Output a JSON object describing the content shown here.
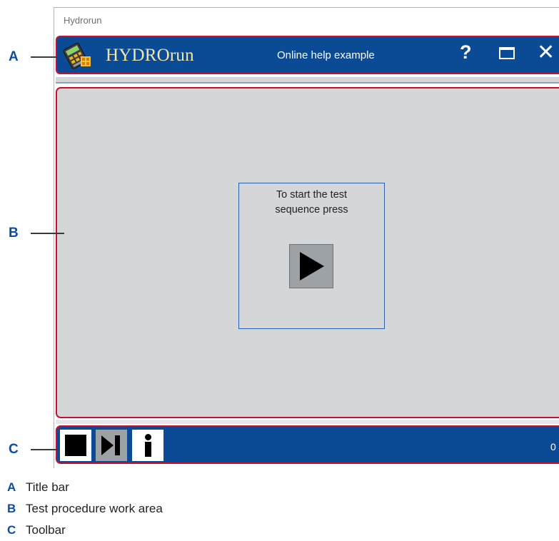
{
  "window": {
    "caption": "Hydrorun"
  },
  "titlebar": {
    "app_name": "HYDROrun",
    "subtitle": "Online help example",
    "help_label": "?",
    "close_label": "✕",
    "icons": [
      "app-logo-icon",
      "help-icon",
      "maximize-icon",
      "close-icon"
    ]
  },
  "workarea": {
    "prompt_line1": "To start the test",
    "prompt_line2": "sequence press",
    "play_icon": "play-icon"
  },
  "toolbar": {
    "icons": [
      "stop-icon",
      "skip-next-icon",
      "info-icon"
    ],
    "clock_partial": "0"
  },
  "callouts": {
    "a": "A",
    "b": "B",
    "c": "C"
  },
  "legend": [
    {
      "key": "A",
      "label": "Title bar"
    },
    {
      "key": "B",
      "label": "Test procedure work area"
    },
    {
      "key": "C",
      "label": "Toolbar"
    }
  ],
  "colors": {
    "bar_blue": "#0b4b96",
    "highlight_red": "#c8102e",
    "work_gray": "#d4d6d8",
    "callout_blue": "#0c4da2",
    "app_name_yellow": "#f2e7a8"
  }
}
